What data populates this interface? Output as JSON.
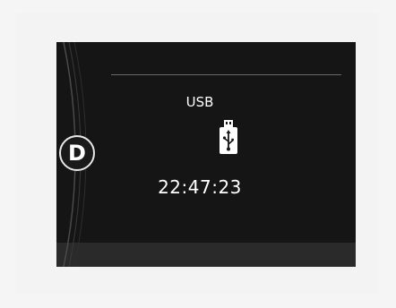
{
  "gear": {
    "label": "D"
  },
  "media": {
    "source_label": "USB",
    "source_icon": "usb-drive-icon",
    "time": "22:47:23"
  },
  "colors": {
    "display_background": "#151515",
    "text": "#ffffff"
  }
}
